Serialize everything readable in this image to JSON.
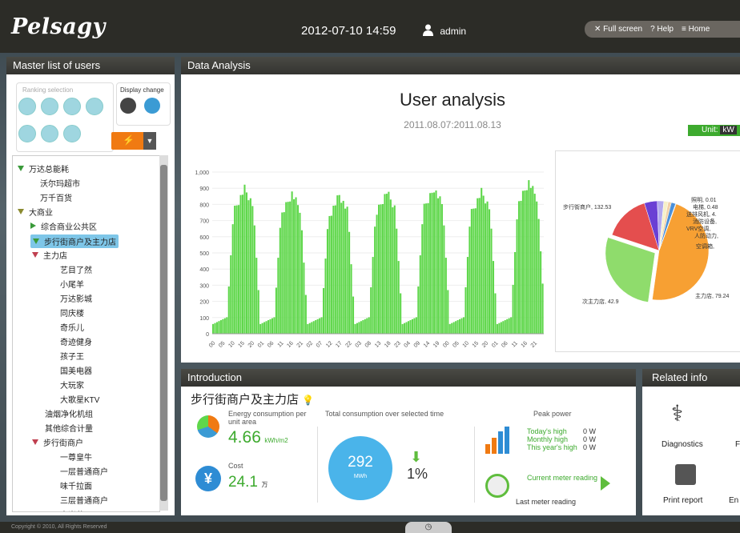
{
  "header": {
    "logo": "Pelsagy",
    "datetime": "2012-07-10 14:59",
    "user": "admin",
    "nav": [
      "Full screen",
      "Help",
      "Home"
    ]
  },
  "left_panel": {
    "title": "Master list of users",
    "ranking_label": "Ranking selection",
    "display_label": "Display change",
    "tree": [
      {
        "label": "万达总能耗",
        "icon": "triangle-down-green",
        "level": 0
      },
      {
        "label": "沃尔玛超市",
        "icon": "none",
        "level": 1
      },
      {
        "label": "万千百货",
        "icon": "none",
        "level": 1
      },
      {
        "label": "大商业",
        "icon": "triangle-down-olive",
        "level": 0
      },
      {
        "label": "综合商业公共区",
        "icon": "triangle-right-green",
        "level": 1
      },
      {
        "label": "步行街商户及主力店",
        "icon": "triangle-down-green",
        "level": 1,
        "selected": true
      },
      {
        "label": "主力店",
        "icon": "triangle-down-red",
        "level": 2
      },
      {
        "label": "艺目了然",
        "icon": "none",
        "level": 3
      },
      {
        "label": "小尾羊",
        "icon": "none",
        "level": 3
      },
      {
        "label": "万达影城",
        "icon": "none",
        "level": 3
      },
      {
        "label": "同庆楼",
        "icon": "none",
        "level": 3
      },
      {
        "label": "奇乐儿",
        "icon": "none",
        "level": 3
      },
      {
        "label": "奇迹健身",
        "icon": "none",
        "level": 3
      },
      {
        "label": "孩子王",
        "icon": "none",
        "level": 3
      },
      {
        "label": "国美电器",
        "icon": "none",
        "level": 3
      },
      {
        "label": "大玩家",
        "icon": "none",
        "level": 3
      },
      {
        "label": "大歌星KTV",
        "icon": "none",
        "level": 3
      },
      {
        "label": "油烟净化机组",
        "icon": "none",
        "level": 2
      },
      {
        "label": "其他综合计量",
        "icon": "none",
        "level": 2
      },
      {
        "label": "步行街商户",
        "icon": "triangle-down-red",
        "level": 2
      },
      {
        "label": "一尊皇牛",
        "icon": "none",
        "level": 3
      },
      {
        "label": "一层普通商户",
        "icon": "none",
        "level": 3
      },
      {
        "label": "味千拉面",
        "icon": "none",
        "level": 3
      },
      {
        "label": "三层普通商户",
        "icon": "none",
        "level": 3
      },
      {
        "label": "麦当劳",
        "icon": "none",
        "level": 3
      }
    ]
  },
  "data_analysis": {
    "title": "Data Analysis",
    "chart_title": "User analysis",
    "chart_subtitle": "2011.08.07:2011.08.13",
    "unit_label": "Unit:",
    "unit_value": "kW"
  },
  "chart_data": [
    {
      "type": "bar",
      "title": "",
      "ylim": [
        0,
        1000
      ],
      "yticks": [
        "0",
        "100",
        "200",
        "300",
        "400",
        "500",
        "600",
        "700",
        "800",
        "900",
        "1,000"
      ],
      "xticks": [
        "00",
        "05",
        "10",
        "15",
        "20",
        "01",
        "06",
        "11",
        "16",
        "21",
        "02",
        "07",
        "12",
        "17",
        "22",
        "03",
        "08",
        "13",
        "18",
        "23",
        "04",
        "09",
        "14",
        "19",
        "00",
        "05",
        "10",
        "15",
        "20",
        "01",
        "06",
        "11",
        "16",
        "21"
      ],
      "daily_peaks": [
        870,
        840,
        830,
        850,
        870,
        850,
        910
      ],
      "color": "#5fd74b"
    },
    {
      "type": "pie",
      "slices": [
        {
          "label": "步行街商户",
          "value": 132.53,
          "color": "#f7a033"
        },
        {
          "label": "主力店",
          "value": 79.24,
          "color": "#8fdc6c"
        },
        {
          "label": "次主力店",
          "value": 42.9,
          "color": "#e44e4e"
        },
        {
          "label": "空调箱",
          "value": 12.0,
          "color": "#6a3fd4"
        },
        {
          "label": "人防动力",
          "value": 6.0,
          "color": "#b3a9ef"
        },
        {
          "label": "VRV空调",
          "value": 4.0,
          "color": "#f6f0c8"
        },
        {
          "label": "消防设备",
          "value": 3.0,
          "color": "#f2d0a8"
        },
        {
          "label": "送排风机",
          "value": 4.0,
          "color": "#4a90d9"
        },
        {
          "label": "电梯",
          "value": 0.48,
          "color": "#3a6fa8"
        },
        {
          "label": "照明",
          "value": 0.01,
          "color": "#ccc"
        }
      ],
      "label_texts": [
        "步行街商户, 132.53",
        "主力店, 79.24",
        "次主力店, 42.9",
        "照明, 0.01",
        "电梯, 0.48",
        "送排风机, 4.",
        "消防设备,",
        "VRV空调,",
        "人防动力,",
        "空调箱,"
      ]
    }
  ],
  "introduction": {
    "title": "Introduction",
    "store_name": "步行街商户及主力店",
    "energy_label": "Energy consumption per unit area",
    "energy_value": "4.66",
    "energy_unit": "kWh/m2",
    "cost_label": "Cost",
    "cost_value": "24.1",
    "cost_unit": "万",
    "total_label": "Total consumption over selected time",
    "total_value": "292",
    "total_unit": "MWh",
    "change_value": "1%",
    "peak_label": "Peak power",
    "peaks": [
      {
        "label": "Today's high",
        "value": "0 W"
      },
      {
        "label": "Monthly high",
        "value": "0 W"
      },
      {
        "label": "This year's high",
        "value": "0 W"
      }
    ],
    "current_meter": "Current meter reading",
    "last_meter": "Last meter reading"
  },
  "related": {
    "title": "Related info",
    "items": [
      "Diagnostics",
      "F",
      "Print report",
      "En"
    ]
  },
  "footer": "Copyright © 2010, All Rights Reserved"
}
